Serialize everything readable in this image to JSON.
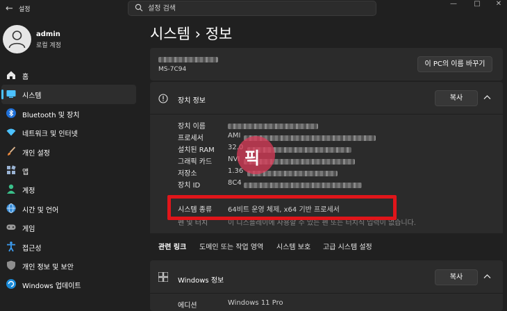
{
  "titlebar": {
    "app_title": "설정",
    "search_placeholder": "설정 검색"
  },
  "profile": {
    "name": "admin",
    "account_type": "로컬 계정"
  },
  "sidebar": {
    "items": [
      {
        "label": "홈",
        "icon": "home-icon"
      },
      {
        "label": "시스템",
        "icon": "system-icon",
        "active": true
      },
      {
        "label": "Bluetooth 및 장치",
        "icon": "bluetooth-icon"
      },
      {
        "label": "네트워크 및 인터넷",
        "icon": "wifi-icon"
      },
      {
        "label": "개인 설정",
        "icon": "brush-icon"
      },
      {
        "label": "앱",
        "icon": "apps-icon"
      },
      {
        "label": "계정",
        "icon": "account-icon"
      },
      {
        "label": "시간 및 언어",
        "icon": "globe-icon"
      },
      {
        "label": "게임",
        "icon": "gamepad-icon"
      },
      {
        "label": "접근성",
        "icon": "accessibility-icon"
      },
      {
        "label": "개인 정보 및 보안",
        "icon": "shield-icon"
      },
      {
        "label": "Windows 업데이트",
        "icon": "update-icon"
      }
    ]
  },
  "page": {
    "title": "시스템 › 정보"
  },
  "pc": {
    "model": "MS-7C94",
    "rename_label": "이 PC의 이름 바꾸기"
  },
  "device_specs": {
    "title": "장치 정보",
    "copy_label": "복사",
    "rows": [
      {
        "key": "장치 이름",
        "value": ""
      },
      {
        "key": "프로세서",
        "value": "AMI"
      },
      {
        "key": "설치된 RAM",
        "value": "32.0"
      },
      {
        "key": "그래픽 카드",
        "value": "NVI"
      },
      {
        "key": "저장소",
        "value": "1.36"
      },
      {
        "key": "장치 ID",
        "value": "8C4"
      },
      {
        "key": "시스템 종류",
        "value": "64비트 운영 체제, x64 기반 프로세서"
      },
      {
        "key": "펜 및 터치",
        "value": "이 디스플레이에 사용할 수 있는 펜 또는 터치식 입력이 없습니다."
      }
    ]
  },
  "watermark": {
    "text": "픽"
  },
  "related": {
    "label": "관련 링크",
    "links": [
      "도메인 또는 작업 영역",
      "시스템 보호",
      "고급 시스템 설정"
    ]
  },
  "windows_specs": {
    "title": "Windows 정보",
    "copy_label": "복사",
    "rows": [
      {
        "key": "에디션",
        "value": "Windows 11 Pro"
      }
    ]
  },
  "colors": {
    "accent": "#4cc2ff",
    "highlight_box": "#e0151a",
    "background": "#202020",
    "card": "#2b2b2b"
  }
}
